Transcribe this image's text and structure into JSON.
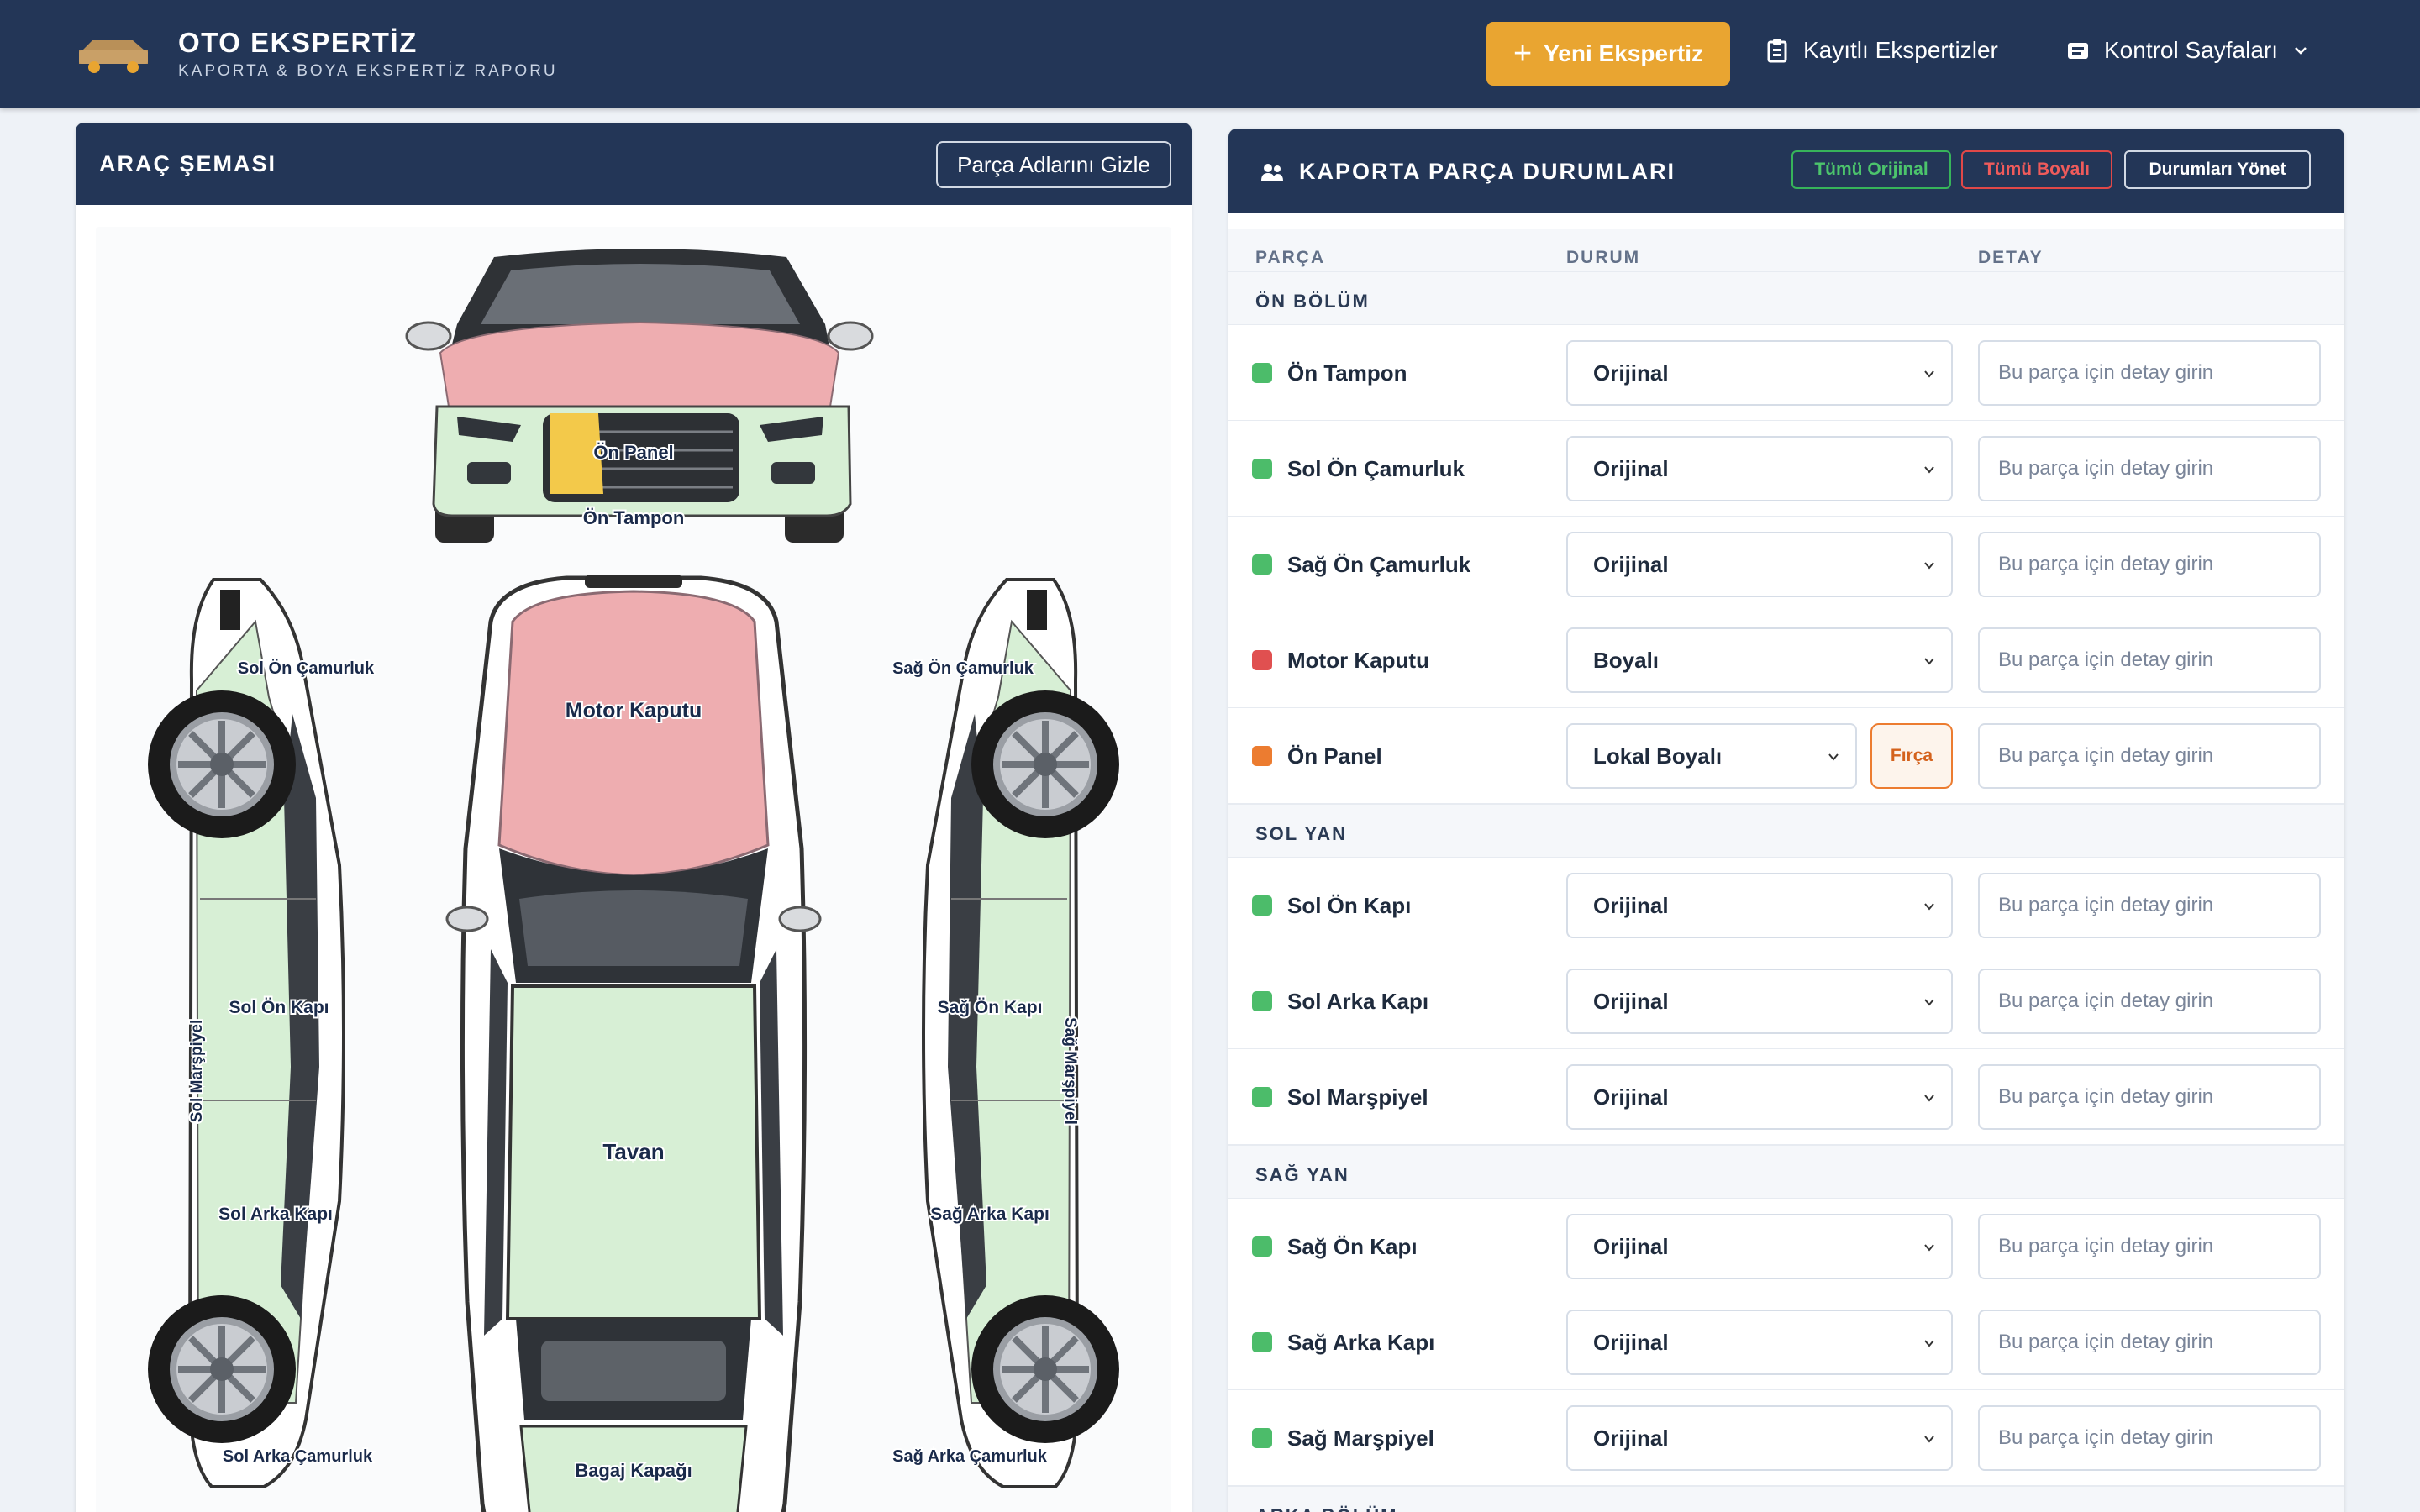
{
  "header": {
    "title": "OTO EKSPERTİZ",
    "subtitle": "KAPORTA & BOYA EKSPERTİZ RAPORU",
    "new_button": "Yeni Ekspertiz",
    "saved_link": "Kayıtlı Ekspertizler",
    "control_link": "Kontrol Sayfaları"
  },
  "left_panel": {
    "title": "ARAÇ ŞEMASI",
    "hide_button": "Parça Adlarını Gizle",
    "labels": {
      "on_panel": "Ön Panel",
      "on_tampon": "Ön Tampon",
      "sol_on_camurluk": "Sol Ön Çamurluk",
      "sag_on_camurluk": "Sağ Ön Çamurluk",
      "motor_kaputu": "Motor Kaputu",
      "sol_on_kapi": "Sol Ön Kapı",
      "sag_on_kapi": "Sağ Ön Kapı",
      "sol_marspiyel": "Sol Marşpiyel",
      "sag_marspiyel": "Sağ Marşpiyel",
      "tavan": "Tavan",
      "sol_arka_kapi": "Sol Arka Kapı",
      "sag_arka_kapi": "Sağ Arka Kapı",
      "sol_arka_camurluk": "Sol Arka Çamurluk",
      "sag_arka_camurluk": "Sağ Arka Çamurluk",
      "bagaj_kapagi": "Bagaj Kapağı"
    }
  },
  "right_panel": {
    "title": "KAPORTA PARÇA DURUMLARI",
    "btn_all_original": "Tümü Orijinal",
    "btn_all_painted": "Tümü Boyalı",
    "btn_manage": "Durumları Yönet",
    "col_part": "PARÇA",
    "col_status": "DURUM",
    "col_detail": "DETAY",
    "detail_placeholder": "Bu parça için detay girin",
    "brush_button": "Fırça",
    "sections": [
      {
        "name": "ÖN BÖLÜM",
        "rows": [
          {
            "part": "Ön Tampon",
            "status": "Orijinal"
          },
          {
            "part": "Sol Ön Çamurluk",
            "status": "Orijinal"
          },
          {
            "part": "Sağ Ön Çamurluk",
            "status": "Orijinal"
          },
          {
            "part": "Motor Kaputu",
            "status": "Boyalı"
          },
          {
            "part": "Ön Panel",
            "status": "Lokal Boyalı"
          }
        ]
      },
      {
        "name": "SOL YAN",
        "rows": [
          {
            "part": "Sol Ön Kapı",
            "status": "Orijinal"
          },
          {
            "part": "Sol Arka Kapı",
            "status": "Orijinal"
          },
          {
            "part": "Sol Marşpiyel",
            "status": "Orijinal"
          }
        ]
      },
      {
        "name": "SAĞ YAN",
        "rows": [
          {
            "part": "Sağ Ön Kapı",
            "status": "Orijinal"
          },
          {
            "part": "Sağ Arka Kapı",
            "status": "Orijinal"
          },
          {
            "part": "Sağ Marşpiyel",
            "status": "Orijinal"
          }
        ]
      },
      {
        "name": "ARKA BÖLÜM",
        "rows": []
      }
    ]
  },
  "colors": {
    "original": "#4cbc6a",
    "painted": "#e05050",
    "local_painted": "#ec7c30",
    "changed": "#f3c94a",
    "header_bg": "#233657",
    "accent": "#e9a531"
  }
}
